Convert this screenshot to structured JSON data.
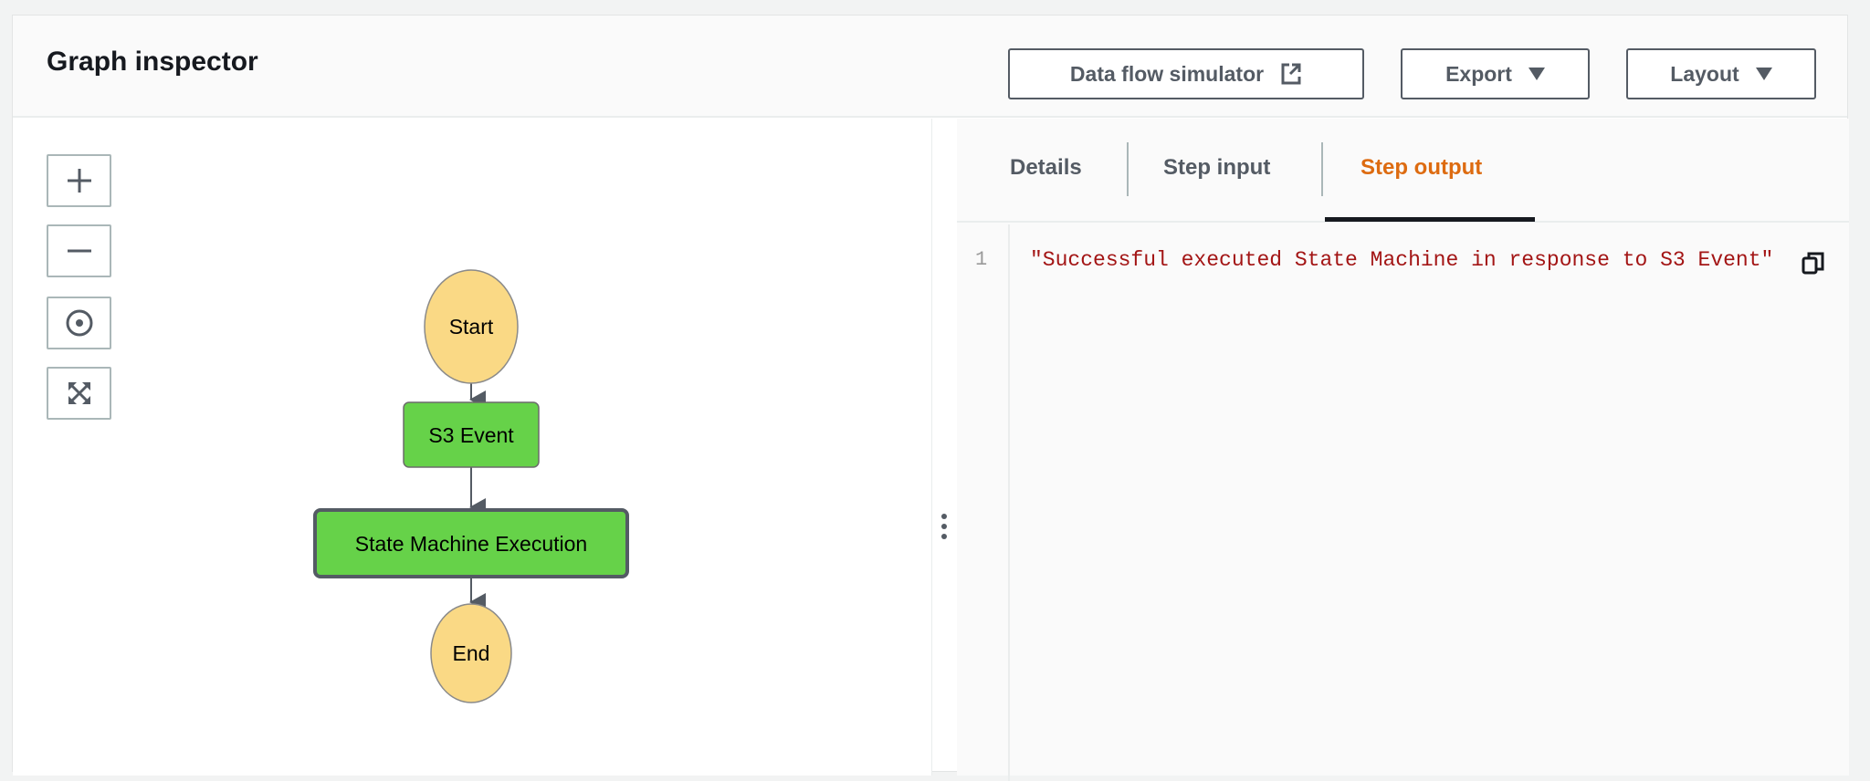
{
  "header": {
    "title": "Graph inspector",
    "buttons": {
      "data_flow_simulator": "Data flow simulator",
      "export": "Export",
      "layout": "Layout"
    }
  },
  "graph": {
    "nodes": {
      "start": "Start",
      "s3_event": "S3 Event",
      "state_machine_execution": "State Machine Execution",
      "end": "End"
    },
    "colors": {
      "terminal": "#fad985",
      "task": "#66d249"
    }
  },
  "tabs": {
    "details": "Details",
    "step_input": "Step input",
    "step_output": "Step output",
    "active": "Step output"
  },
  "code": {
    "line_number": "1",
    "content": "\"Successful executed State Machine in response to S3 Event\""
  }
}
